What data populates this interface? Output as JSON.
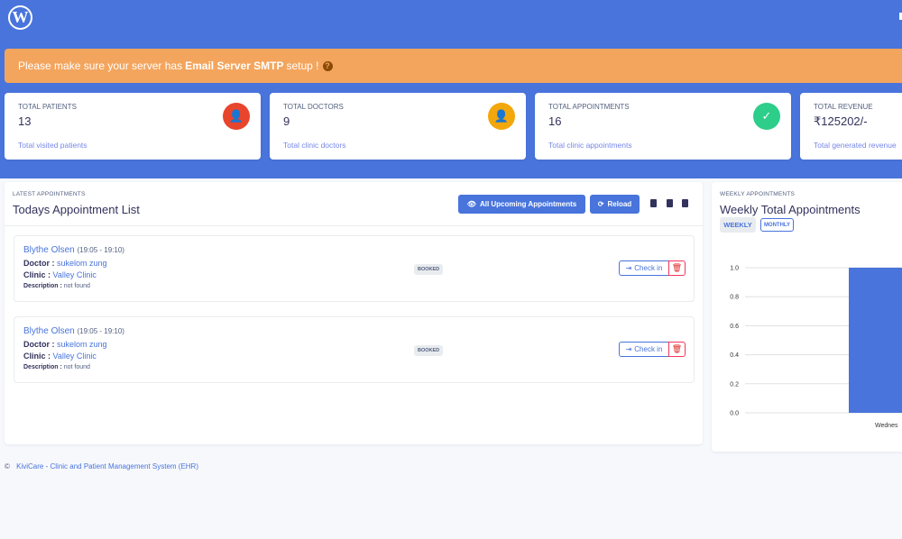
{
  "topbar": {
    "logo_glyph": "W",
    "logo_icon": "wordpress-icon"
  },
  "alert": {
    "prefix": "Please make sure your server has",
    "strong": "Email Server SMTP",
    "suffix": "setup !",
    "help_glyph": "?"
  },
  "stats": [
    {
      "title": "Total Patients",
      "value": "13",
      "description": "Total visited patients",
      "icon": "patient-icon",
      "glyph": "👤",
      "color": "#e8452c"
    },
    {
      "title": "Total Doctors",
      "value": "9",
      "description": "Total clinic doctors",
      "icon": "doctor-icon",
      "glyph": "👤",
      "color": "#f2a70c"
    },
    {
      "title": "Total Appointments",
      "value": "16",
      "description": "Total clinic appointments",
      "icon": "calendar-check-icon",
      "glyph": "✓",
      "color": "#2dce89"
    },
    {
      "title": "Total Revenue",
      "value": "₹125202/-",
      "description": "Total generated revenue",
      "icon": "revenue-icon",
      "glyph": "",
      "color": "#4874dc"
    }
  ],
  "appointments_panel": {
    "caption": "Latest Appointments",
    "title": "Todays Appointment List",
    "all_upcoming_label": "All Upcoming Appointments",
    "reload_label": "Reload",
    "items": [
      {
        "patient": "Blythe Olsen",
        "time": "(19:05 - 19:10)",
        "doctor_label": "Doctor :",
        "doctor": "sukelom zung",
        "clinic_label": "Clinic :",
        "clinic": "Valley Clinic",
        "description_label": "Description :",
        "description": "not found",
        "status": "BOOKED",
        "checkin_label": "Check in"
      },
      {
        "patient": "Blythe Olsen",
        "time": "(19:05 - 19:10)",
        "doctor_label": "Doctor :",
        "doctor": "sukelom zung",
        "clinic_label": "Clinic :",
        "clinic": "Valley Clinic",
        "description_label": "Description :",
        "description": "not found",
        "status": "BOOKED",
        "checkin_label": "Check in"
      }
    ]
  },
  "weekly_panel": {
    "caption": "Weekly Appointments",
    "title": "Weekly Total Appointments",
    "tabs": [
      {
        "label": "WEEKLY",
        "active": true
      },
      {
        "label": "MONTHLY",
        "active": false
      }
    ]
  },
  "chart_data": {
    "type": "bar",
    "title": "Weekly Total Appointments",
    "categories": [
      "Wednesday"
    ],
    "values": [
      1
    ],
    "visible_category_label": "Wednes",
    "xlabel": "",
    "ylabel": "",
    "ylim": [
      0,
      1.0
    ],
    "yticks": [
      "0.0",
      "0.2",
      "0.4",
      "0.6",
      "0.8",
      "1.0"
    ],
    "grid": true,
    "bar_color": "#4874dc"
  },
  "footer": {
    "copyright": "©",
    "text": "KiviCare - Clinic and Patient Management System (EHR)"
  }
}
